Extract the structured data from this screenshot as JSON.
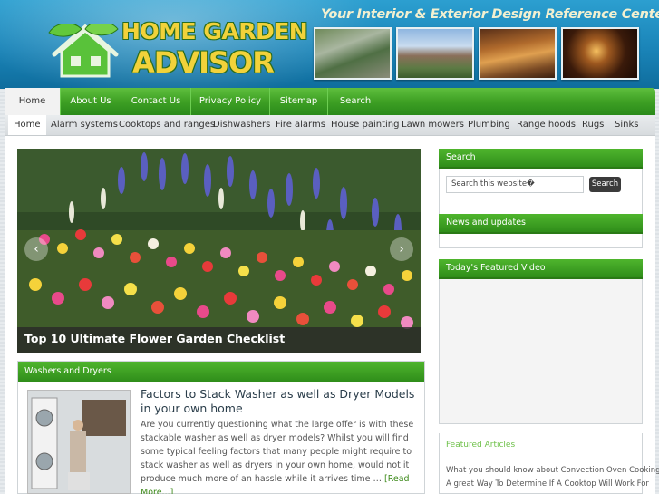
{
  "header": {
    "logo_line1": "HOME GARDEN",
    "logo_line2": "ADVISOR",
    "tagline": "Your Interior & Exterior Design Reference Center",
    "brand_color": "#1a84b8",
    "logo_color": "#f2d23a"
  },
  "nav_primary": [
    {
      "label": "Home",
      "active": true
    },
    {
      "label": "About Us"
    },
    {
      "label": "Contact Us"
    },
    {
      "label": "Privacy Policy"
    },
    {
      "label": "Sitemap"
    },
    {
      "label": "Search"
    }
  ],
  "nav_secondary": [
    {
      "label": "Home",
      "active": true
    },
    {
      "label": "Alarm systems"
    },
    {
      "label": "Cooktops and ranges"
    },
    {
      "label": "Dishwashers"
    },
    {
      "label": "Fire alarms"
    },
    {
      "label": "House painting"
    },
    {
      "label": "Lawn mowers"
    },
    {
      "label": "Plumbing"
    },
    {
      "label": "Range hoods"
    },
    {
      "label": "Rugs"
    },
    {
      "label": "Sinks"
    }
  ],
  "slider": {
    "caption": "Top 10 Ultimate Flower Garden Checklist"
  },
  "section": {
    "title": "Washers and Dryers",
    "article_title": "Factors to Stack Washer as well as Dryer Models in your own home",
    "article_body": "Are you currently questioning what the large offer is with these stackable washer as well as dryer models? Whilst you will find some typical feeling factors that many people might require to stack washer as well as dryers in your own home, would not it produce much more of an hassle while it arrives time … ",
    "read_more": "[Read More...]"
  },
  "sidebar": {
    "search_title": "Search",
    "search_placeholder": "Search this website�",
    "search_button": "Search",
    "news_title": "News and updates",
    "video_title": "Today's Featured Video",
    "featured_title": "Featured Articles",
    "featured_links": [
      "What you should know about Convection Oven Cooking",
      "A great Way To Determine If A Cooktop Will Work For"
    ]
  },
  "colors": {
    "nav_green": "#3ea024",
    "link_green": "#3d8a1a"
  }
}
